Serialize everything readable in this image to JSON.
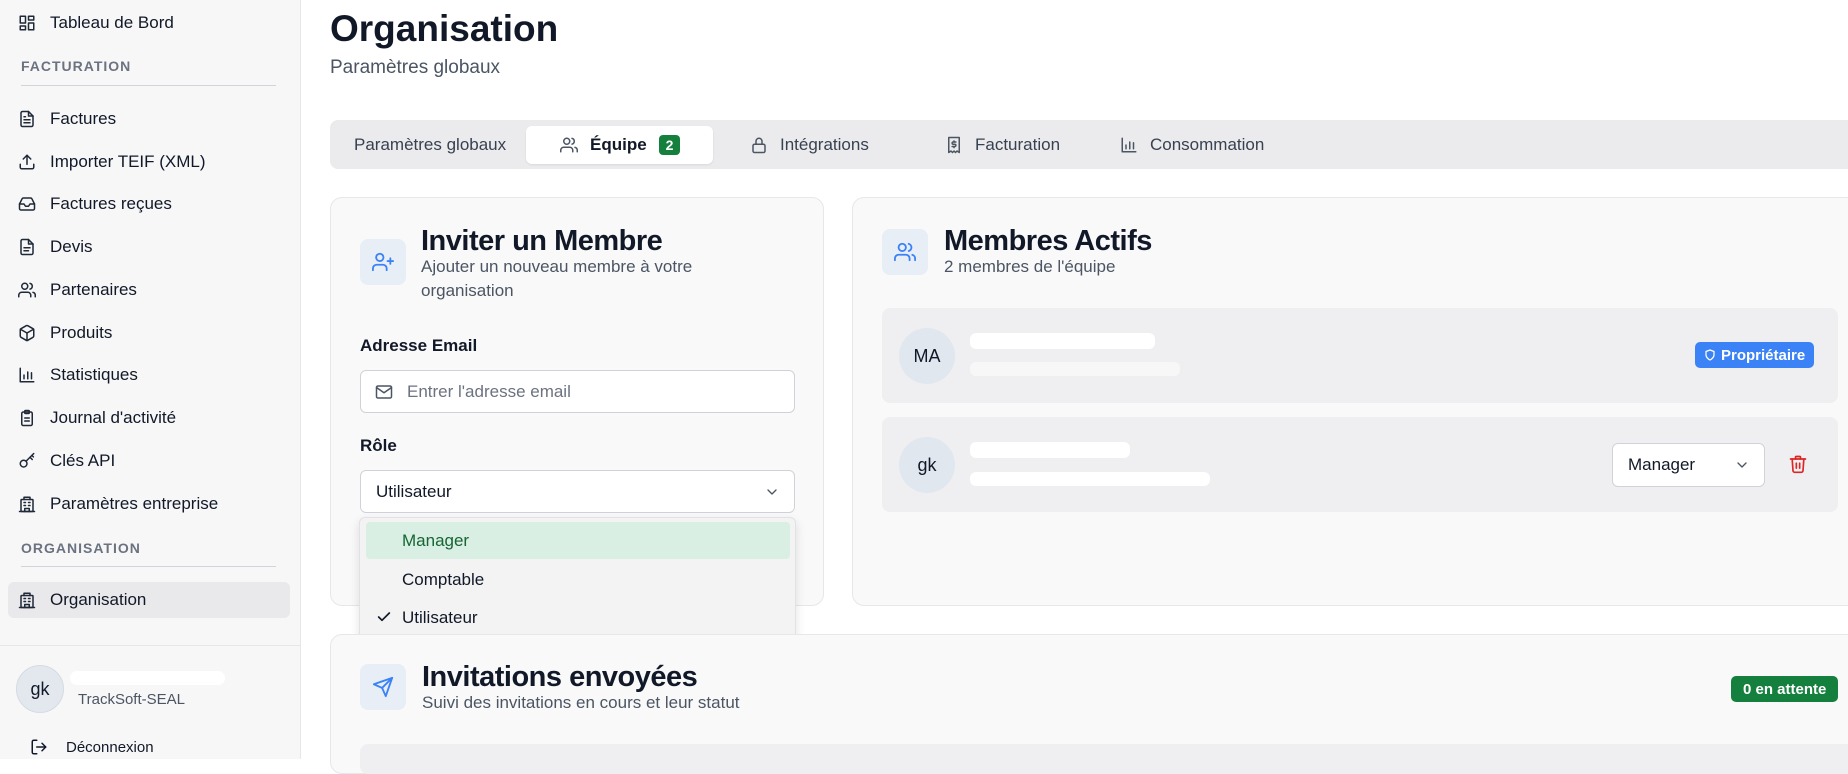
{
  "sidebar": {
    "top_item": "Tableau de Bord",
    "section_billing": "FACTURATION",
    "items": [
      {
        "label": "Factures",
        "icon": "file-text-icon"
      },
      {
        "label": "Importer TEIF (XML)",
        "icon": "upload-icon"
      },
      {
        "label": "Factures reçues",
        "icon": "inbox-icon"
      },
      {
        "label": "Devis",
        "icon": "file-icon"
      },
      {
        "label": "Partenaires",
        "icon": "users-icon"
      },
      {
        "label": "Produits",
        "icon": "package-icon"
      },
      {
        "label": "Statistiques",
        "icon": "bar-chart-icon"
      },
      {
        "label": "Journal d'activité",
        "icon": "clipboard-icon"
      },
      {
        "label": "Clés API",
        "icon": "key-icon"
      },
      {
        "label": "Paramètres entreprise",
        "icon": "building-icon"
      }
    ],
    "section_org": "ORGANISATION",
    "org_item": "Organisation",
    "user": {
      "initials": "gk",
      "org": "TrackSoft-SEAL"
    },
    "logout": "Déconnexion"
  },
  "page": {
    "title": "Organisation",
    "subtitle": "Paramètres globaux"
  },
  "tabs": [
    {
      "label": "Paramètres globaux",
      "icon": ""
    },
    {
      "label": "Équipe",
      "icon": "users-icon",
      "badge": "2",
      "active": true
    },
    {
      "label": "Intégrations",
      "icon": "lock-icon"
    },
    {
      "label": "Facturation",
      "icon": "receipt-icon"
    },
    {
      "label": "Consommation",
      "icon": "bar-chart-icon"
    }
  ],
  "invite": {
    "title": "Inviter un Membre",
    "subtitle": "Ajouter un nouveau membre à votre organisation",
    "email_label": "Adresse Email",
    "email_placeholder": "Entrer l'adresse email",
    "role_label": "Rôle",
    "role_value": "Utilisateur",
    "role_options": [
      "Manager",
      "Comptable",
      "Utilisateur"
    ]
  },
  "members": {
    "title": "Membres Actifs",
    "subtitle": "2 membres de l'équipe",
    "rows": [
      {
        "initials": "MA",
        "badge": "Propriétaire"
      },
      {
        "initials": "gk",
        "role": "Manager"
      }
    ]
  },
  "invitations": {
    "title": "Invitations envoyées",
    "subtitle": "Suivi des invitations en cours et leur statut",
    "badge": "0 en attente"
  },
  "colors": {
    "accent_blue": "#3b82f6",
    "success_green": "#15803d",
    "danger_red": "#dc2626"
  }
}
